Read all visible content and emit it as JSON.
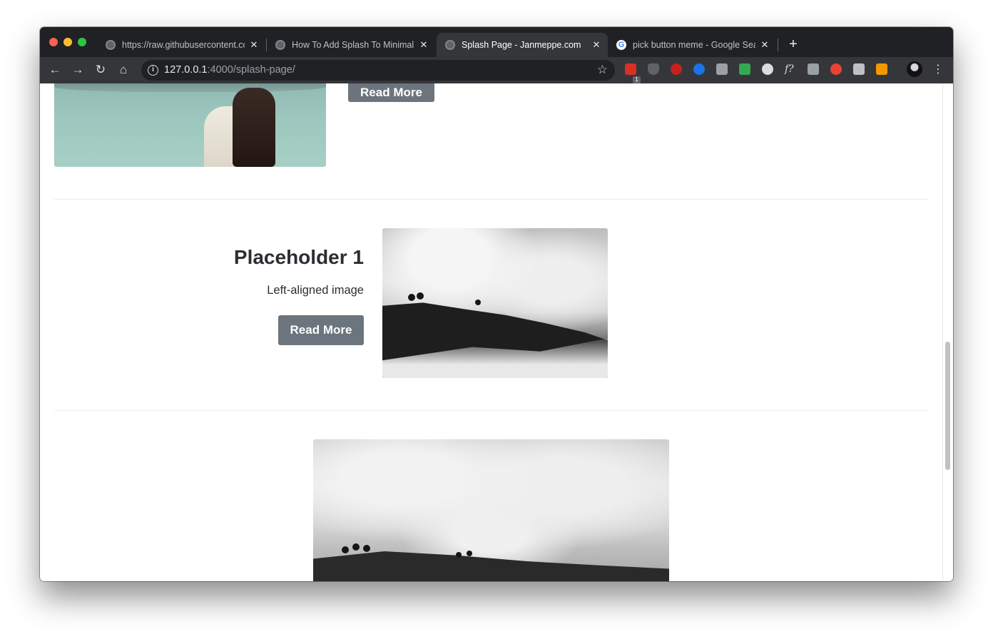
{
  "browser": {
    "tabs": [
      {
        "label": "https://raw.githubusercontent.com",
        "favicon": "globe-icon",
        "active": false
      },
      {
        "label": "How To Add Splash To Minimal Mistakes",
        "favicon": "globe-icon",
        "active": false
      },
      {
        "label": "Splash Page - Janmeppe.com",
        "favicon": "globe-icon",
        "active": true
      },
      {
        "label": "pick button meme - Google Search",
        "favicon": "google-icon",
        "active": false
      }
    ],
    "new_tab_label": "+",
    "close_glyph": "✕",
    "url_host": "127.0.0.1",
    "url_rest": ":4000/splash-page/",
    "extension_badge": "1",
    "colors": {
      "frame": "#202124",
      "toolbar": "#35363a",
      "omnibox": "#202124"
    }
  },
  "page": {
    "top_button_label": "Read More",
    "feature": {
      "title": "Placeholder 1",
      "excerpt": "Left-aligned image",
      "button_label": "Read More"
    },
    "colors": {
      "button": "#6c757d",
      "text": "#2b2f33"
    }
  }
}
